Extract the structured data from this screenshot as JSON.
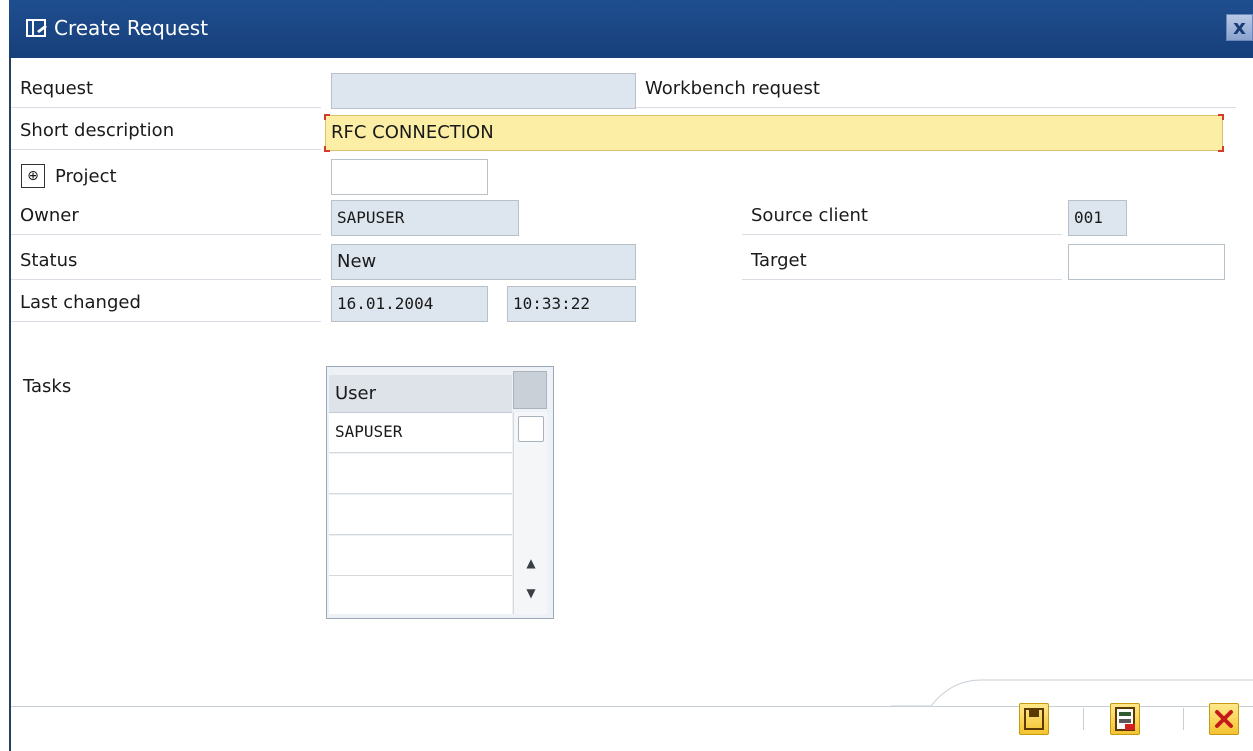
{
  "window": {
    "title": "Create Request",
    "close_glyph": "x"
  },
  "form": {
    "request_label": "Request",
    "request_value": "",
    "request_type_text": "Workbench request",
    "short_description_label": "Short description",
    "short_description_value": "RFC CONNECTION",
    "project_label": "Project",
    "project_value": "",
    "owner_label": "Owner",
    "owner_value": "SAPUSER",
    "status_label": "Status",
    "status_value": "New",
    "last_changed_label": "Last changed",
    "last_changed_date": "16.01.2004",
    "last_changed_time": "10:33:22",
    "source_client_label": "Source client",
    "source_client_value": "001",
    "target_label": "Target",
    "target_value": ""
  },
  "tasks": {
    "label": "Tasks",
    "column_header": "User",
    "rows": [
      "SAPUSER",
      "",
      "",
      "",
      ""
    ]
  },
  "footer": {
    "icons": [
      "save-icon",
      "save-local-icon",
      "cancel-icon"
    ]
  },
  "colors": {
    "titlebar": "#1f4e8f",
    "required_field": "#fcefa5",
    "readonly_field": "#dde6ee",
    "button": "#f4c430"
  }
}
